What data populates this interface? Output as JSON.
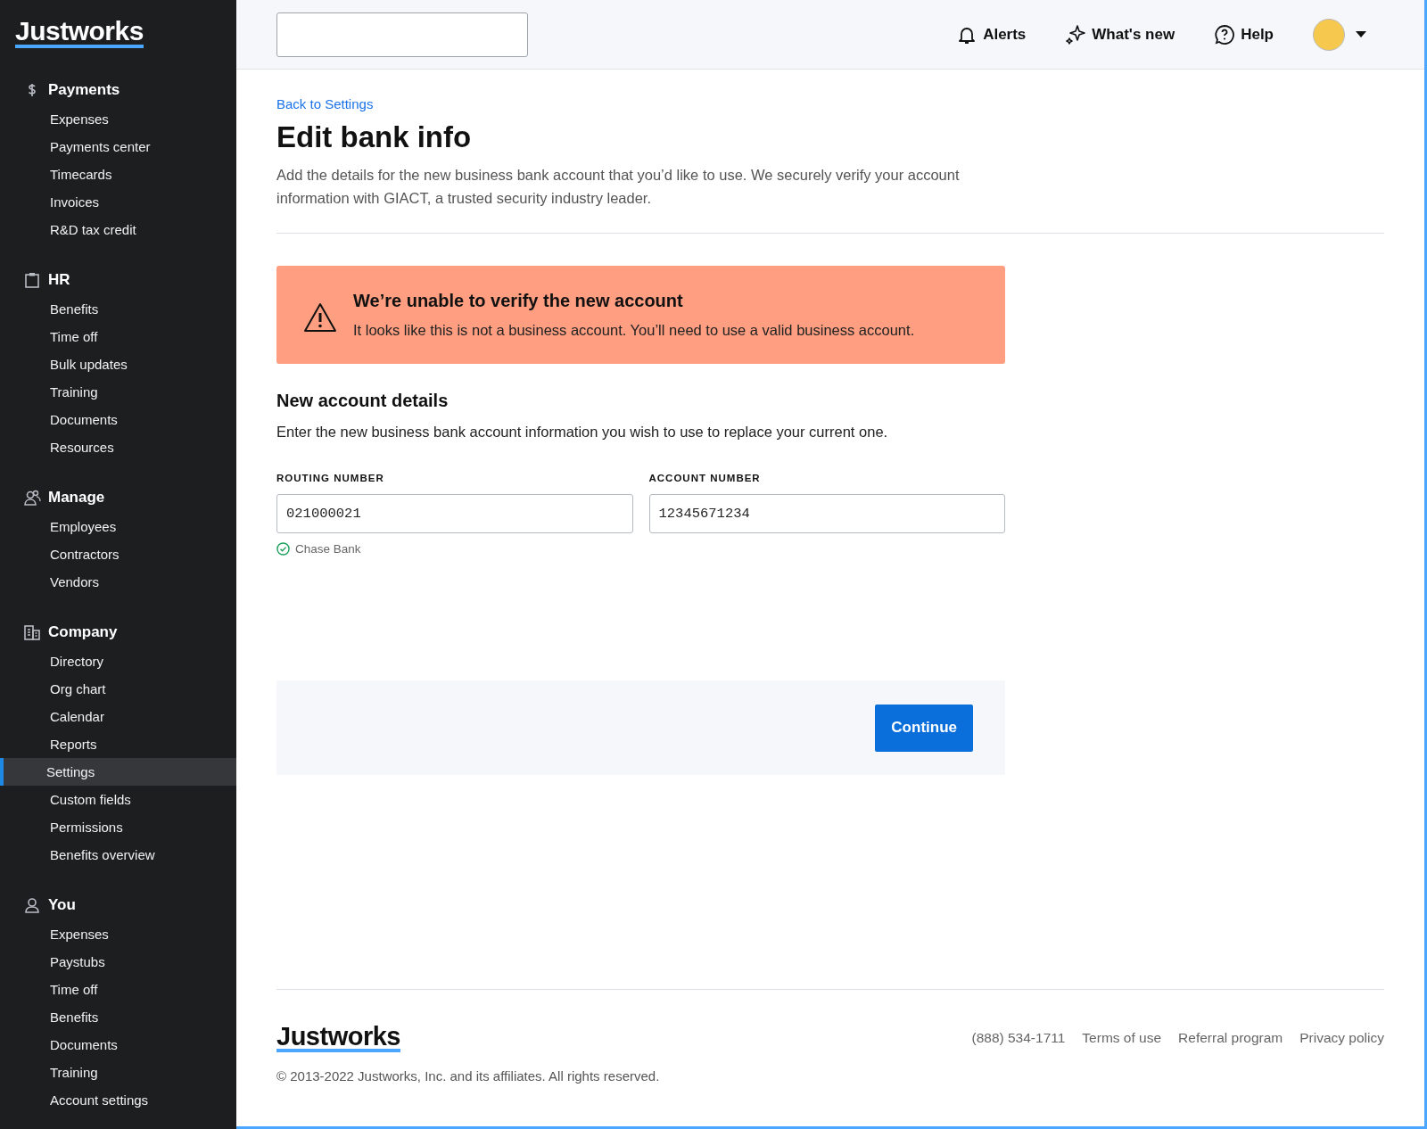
{
  "sidebar": {
    "logo": "Justworks",
    "sections": [
      {
        "kind": "payments",
        "title": "Payments",
        "items": [
          {
            "label": "Expenses",
            "selected": false
          },
          {
            "label": "Payments center",
            "selected": false
          },
          {
            "label": "Timecards",
            "selected": false
          },
          {
            "label": "Invoices",
            "selected": false
          },
          {
            "label": "R&D tax credit",
            "selected": false
          }
        ]
      },
      {
        "kind": "hr",
        "title": "HR",
        "items": [
          {
            "label": "Benefits",
            "selected": false
          },
          {
            "label": "Time off",
            "selected": false
          },
          {
            "label": "Bulk updates",
            "selected": false
          },
          {
            "label": "Training",
            "selected": false
          },
          {
            "label": "Documents",
            "selected": false
          },
          {
            "label": "Resources",
            "selected": false
          }
        ]
      },
      {
        "kind": "manage",
        "title": "Manage",
        "items": [
          {
            "label": "Employees",
            "selected": false
          },
          {
            "label": "Contractors",
            "selected": false
          },
          {
            "label": "Vendors",
            "selected": false
          }
        ]
      },
      {
        "kind": "company",
        "title": "Company",
        "items": [
          {
            "label": "Directory",
            "selected": false
          },
          {
            "label": "Org chart",
            "selected": false
          },
          {
            "label": "Calendar",
            "selected": false
          },
          {
            "label": "Reports",
            "selected": false
          },
          {
            "label": "Settings",
            "selected": true
          },
          {
            "label": "Custom fields",
            "selected": false
          },
          {
            "label": "Permissions",
            "selected": false
          },
          {
            "label": "Benefits overview",
            "selected": false
          }
        ]
      },
      {
        "kind": "you",
        "title": "You",
        "items": [
          {
            "label": "Expenses",
            "selected": false
          },
          {
            "label": "Paystubs",
            "selected": false
          },
          {
            "label": "Time off",
            "selected": false
          },
          {
            "label": "Benefits",
            "selected": false
          },
          {
            "label": "Documents",
            "selected": false
          },
          {
            "label": "Training",
            "selected": false
          },
          {
            "label": "Account settings",
            "selected": false
          }
        ]
      }
    ]
  },
  "header": {
    "actions": [
      {
        "kind": "alerts",
        "label": "Alerts"
      },
      {
        "kind": "new",
        "label": "What's new"
      },
      {
        "kind": "help",
        "label": "Help"
      }
    ]
  },
  "page": {
    "back_link": "Back to Settings",
    "title": "Edit bank info",
    "description": "Add the details for the new business bank account that you’d like to use. We securely verify your account information with GIACT, a trusted security industry leader.",
    "alert": {
      "title": "We’re unable to verify the new account",
      "message": "It looks like this is not a business account. You’ll need to use a valid business account."
    },
    "section_title": "New account details",
    "section_text": "Enter the new business bank account information you wish to use to replace your current one.",
    "fields": [
      {
        "label": "ROUTING NUMBER",
        "value": "021000021",
        "hint": "Chase Bank"
      },
      {
        "label": "ACCOUNT NUMBER",
        "value": "12345671234"
      }
    ],
    "button": "Continue"
  },
  "footer": {
    "logo": "Justworks",
    "links": [
      "(888) 534-1711",
      "Terms of use",
      "Referral program",
      "Privacy policy"
    ],
    "copyright": "© 2013-2022 Justworks, Inc. and its affiliates. All rights reserved."
  }
}
